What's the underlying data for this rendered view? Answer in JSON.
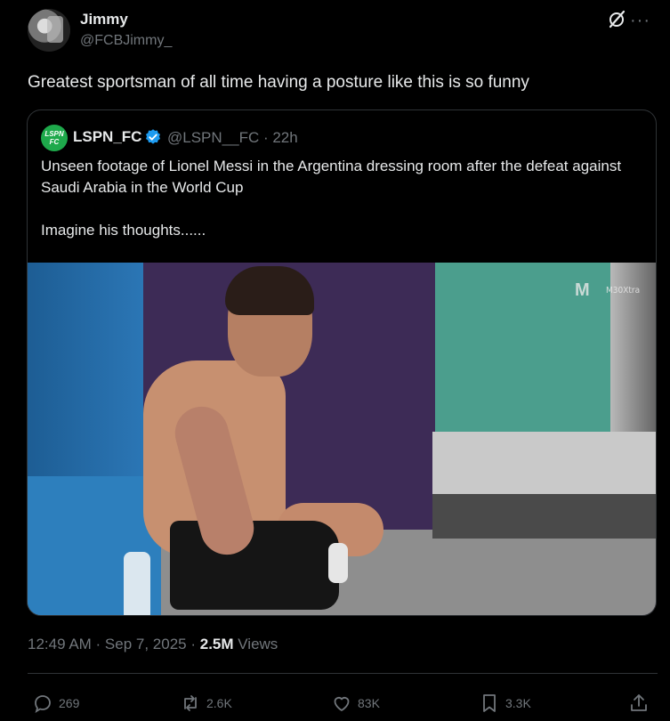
{
  "author": {
    "display_name": "Jimmy",
    "handle": "@FCBJimmy_"
  },
  "tweet": {
    "text": "Greatest sportsman of all time having a posture like this is so funny"
  },
  "quoted": {
    "avatar_text": "LSPN FC",
    "display_name": "LSPN_FC",
    "handle_time": "@LSPN__FC · 22h",
    "text": "Unseen footage of Lionel Messi in the Argentina dressing room after the defeat against Saudi Arabia in the World Cup\n\nImagine his thoughts......",
    "media": {
      "watermark_logo": "M",
      "watermark_text": "M30Xtra"
    }
  },
  "meta": {
    "time_date": "12:49 AM · Sep 7, 2025 · ",
    "views_count": "2.5M",
    "views_label": " Views"
  },
  "actions": {
    "replies": "269",
    "reposts": "2.6K",
    "likes": "83K",
    "bookmarks": "3.3K"
  },
  "colors": {
    "background": "#000000",
    "text_primary": "#e7e9ea",
    "text_secondary": "#71767b",
    "border": "#2f3336",
    "verified": "#1d9bf0"
  }
}
